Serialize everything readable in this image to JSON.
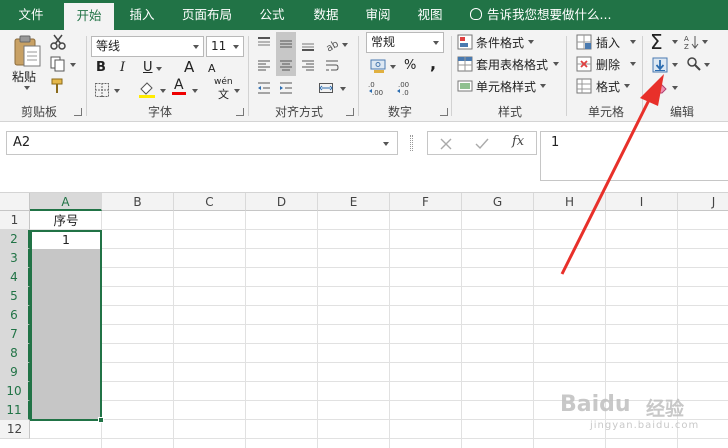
{
  "tabs": [
    {
      "label": "文件",
      "active": false
    },
    {
      "label": "开始",
      "active": true
    },
    {
      "label": "插入",
      "active": false
    },
    {
      "label": "页面布局",
      "active": false
    },
    {
      "label": "公式",
      "active": false
    },
    {
      "label": "数据",
      "active": false
    },
    {
      "label": "审阅",
      "active": false
    },
    {
      "label": "视图",
      "active": false
    }
  ],
  "tell_me": "告诉我您想要做什么...",
  "ribbon": {
    "clipboard": {
      "label": "剪贴板",
      "paste": "粘贴"
    },
    "font": {
      "label": "字体",
      "font_name": "等线",
      "font_size": "11",
      "bold": "B",
      "italic": "I",
      "underline": "U",
      "grow": "A",
      "shrink": "A",
      "wen": "wén",
      "font_color_letter": "A"
    },
    "alignment": {
      "label": "对齐方式"
    },
    "number": {
      "label": "数字",
      "format": "常规",
      "percent": "%",
      "comma": ","
    },
    "styles": {
      "label": "样式",
      "conditional": "条件格式",
      "table": "套用表格格式",
      "cell_styles": "单元格样式"
    },
    "cells": {
      "label": "单元格",
      "insert": "插入",
      "delete": "删除",
      "format": "格式"
    },
    "editing": {
      "label": "编辑",
      "sum": "Σ"
    }
  },
  "formula_bar": {
    "name_box": "A2",
    "fx": "fx",
    "value": "1"
  },
  "sheet": {
    "columns": [
      "A",
      "B",
      "C",
      "D",
      "E",
      "F",
      "G",
      "H",
      "I",
      "J"
    ],
    "rows": [
      "1",
      "2",
      "3",
      "4",
      "5",
      "6",
      "7",
      "8",
      "9",
      "10",
      "11",
      "12"
    ],
    "cells": {
      "A1": "序号",
      "A2": "1"
    },
    "selected_range": "A2:A11"
  },
  "watermark": {
    "brand": "Baidu",
    "suffix": "经验",
    "url": "jingyan.baidu.com"
  },
  "colors": {
    "accent": "#217346",
    "arrow": "#e8302a"
  }
}
